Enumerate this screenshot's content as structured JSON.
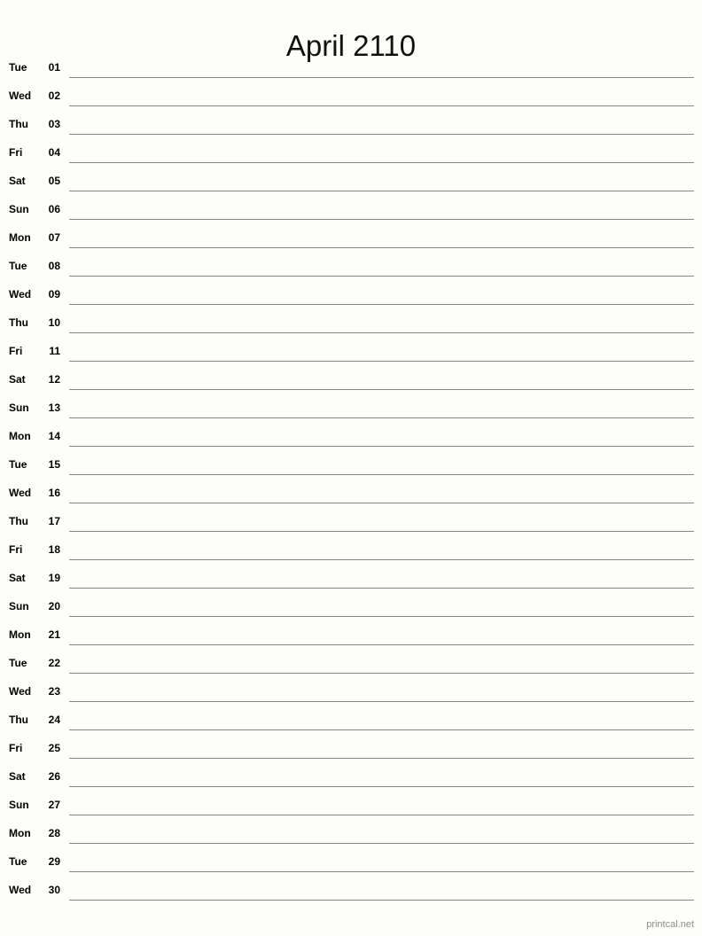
{
  "document": {
    "type": "printable-monthly-calendar",
    "title": "April 2110",
    "month": "April",
    "year": "2110",
    "background_color": "#fdfdfa",
    "rule_color": "#8a8a82",
    "text_color": "#000000"
  },
  "footer": {
    "credit": "printcal.net",
    "color": "#8c8c8c"
  },
  "days": [
    {
      "weekday": "Tue",
      "number": "01"
    },
    {
      "weekday": "Wed",
      "number": "02"
    },
    {
      "weekday": "Thu",
      "number": "03"
    },
    {
      "weekday": "Fri",
      "number": "04"
    },
    {
      "weekday": "Sat",
      "number": "05"
    },
    {
      "weekday": "Sun",
      "number": "06"
    },
    {
      "weekday": "Mon",
      "number": "07"
    },
    {
      "weekday": "Tue",
      "number": "08"
    },
    {
      "weekday": "Wed",
      "number": "09"
    },
    {
      "weekday": "Thu",
      "number": "10"
    },
    {
      "weekday": "Fri",
      "number": "11"
    },
    {
      "weekday": "Sat",
      "number": "12"
    },
    {
      "weekday": "Sun",
      "number": "13"
    },
    {
      "weekday": "Mon",
      "number": "14"
    },
    {
      "weekday": "Tue",
      "number": "15"
    },
    {
      "weekday": "Wed",
      "number": "16"
    },
    {
      "weekday": "Thu",
      "number": "17"
    },
    {
      "weekday": "Fri",
      "number": "18"
    },
    {
      "weekday": "Sat",
      "number": "19"
    },
    {
      "weekday": "Sun",
      "number": "20"
    },
    {
      "weekday": "Mon",
      "number": "21"
    },
    {
      "weekday": "Tue",
      "number": "22"
    },
    {
      "weekday": "Wed",
      "number": "23"
    },
    {
      "weekday": "Thu",
      "number": "24"
    },
    {
      "weekday": "Fri",
      "number": "25"
    },
    {
      "weekday": "Sat",
      "number": "26"
    },
    {
      "weekday": "Sun",
      "number": "27"
    },
    {
      "weekday": "Mon",
      "number": "28"
    },
    {
      "weekday": "Tue",
      "number": "29"
    },
    {
      "weekday": "Wed",
      "number": "30"
    }
  ]
}
